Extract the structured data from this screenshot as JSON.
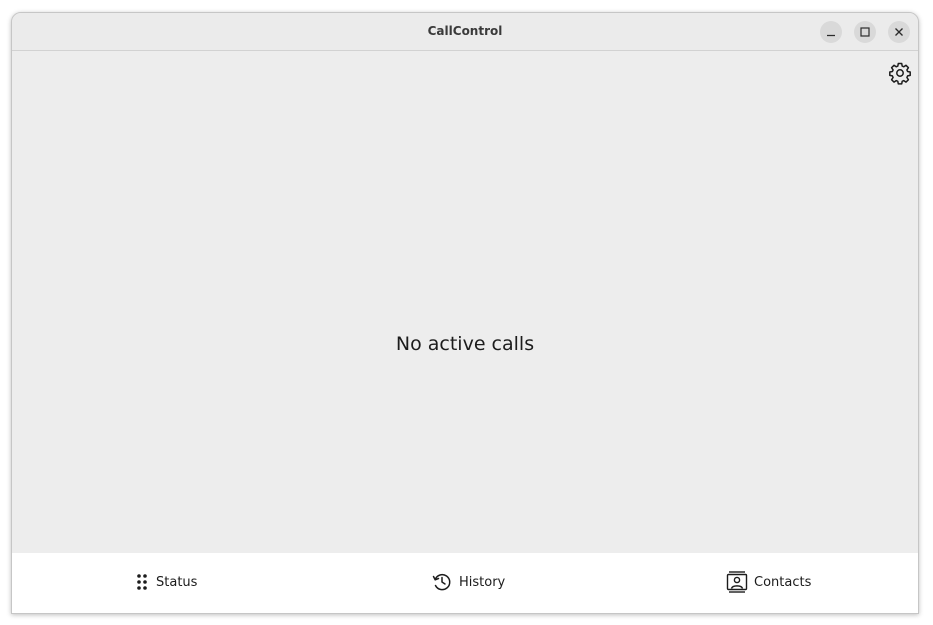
{
  "window": {
    "title": "CallControl",
    "controls": {
      "minimize_icon": "minimize-icon",
      "maximize_icon": "maximize-icon",
      "close_icon": "close-icon"
    }
  },
  "main": {
    "settings_icon": "gear-icon",
    "empty_message": "No active calls"
  },
  "bottom_nav": {
    "items": [
      {
        "label": "Status",
        "icon": "dialpad-icon"
      },
      {
        "label": "History",
        "icon": "history-icon"
      },
      {
        "label": "Contacts",
        "icon": "contacts-icon"
      }
    ]
  }
}
